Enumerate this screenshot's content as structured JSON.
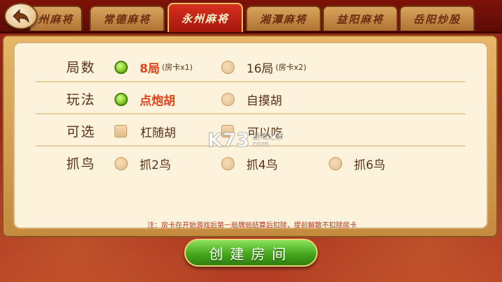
{
  "tabs": [
    {
      "label": "州麻将",
      "active": false
    },
    {
      "label": "常德麻将",
      "active": false
    },
    {
      "label": "永州麻将",
      "active": true
    },
    {
      "label": "湘潭麻将",
      "active": false
    },
    {
      "label": "益阳麻将",
      "active": false
    },
    {
      "label": "岳阳炒股",
      "active": false
    }
  ],
  "rows": {
    "rounds": {
      "label": "局数",
      "options": [
        {
          "label": "8局",
          "sub": "(房卡x1)",
          "selected": true
        },
        {
          "label": "16局",
          "sub": "(房卡x2)",
          "selected": false
        }
      ]
    },
    "play": {
      "label": "玩法",
      "options": [
        {
          "label": "点炮胡",
          "selected": true
        },
        {
          "label": "自摸胡",
          "selected": false
        }
      ]
    },
    "optional": {
      "label": "可选",
      "options": [
        {
          "label": "杠随胡",
          "checked": false
        },
        {
          "label": "可以吃",
          "checked": false
        }
      ]
    },
    "birds": {
      "label": "抓鸟",
      "options": [
        {
          "label": "抓2鸟",
          "selected": false
        },
        {
          "label": "抓4鸟",
          "selected": false
        },
        {
          "label": "抓6鸟",
          "selected": false
        }
      ]
    }
  },
  "note": "注：房卡在开始游戏后第一局牌局结算后扣除，提前解散不扣除房卡",
  "create_button": "创建房间",
  "watermark": {
    "logo": "K73",
    "text_line1": "游戏之家",
    "text_line2": "com"
  },
  "colors": {
    "accent_selected": "#e2431b",
    "button_green": "#45a81d",
    "tab_active": "#c8231a"
  },
  "icons": {
    "back": "back-arrow-icon"
  }
}
